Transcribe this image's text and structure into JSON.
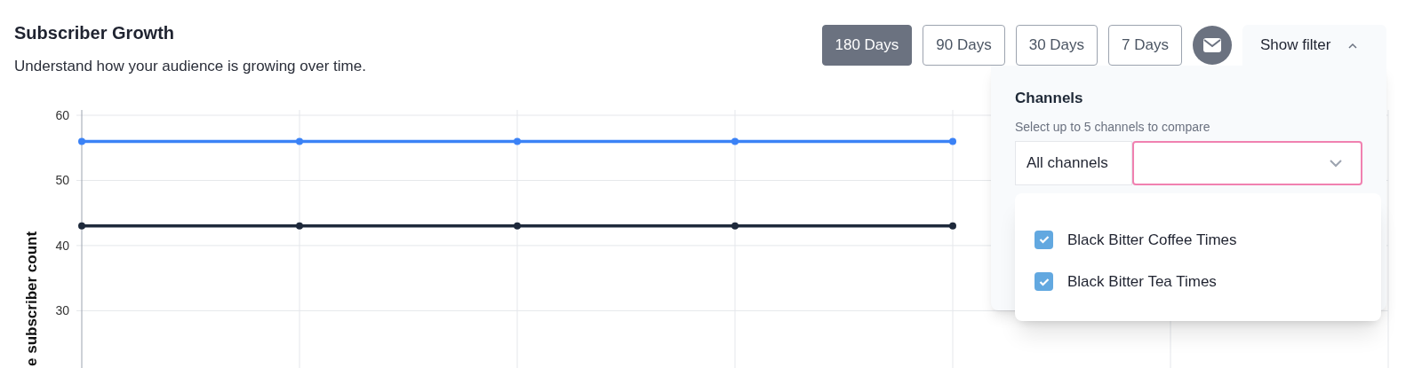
{
  "header": {
    "title": "Subscriber Growth",
    "subtitle": "Understand how your audience is growing over time."
  },
  "range_buttons": [
    {
      "label": "180 Days",
      "selected": true
    },
    {
      "label": "90 Days",
      "selected": false
    },
    {
      "label": "30 Days",
      "selected": false
    },
    {
      "label": "7 Days",
      "selected": false
    }
  ],
  "filter_toggle": {
    "label": "Show filter",
    "expanded": true
  },
  "filter_panel": {
    "title": "Channels",
    "hint": "Select up to 5 channels to compare",
    "scope": "All channels",
    "options": [
      {
        "label": "Black Bitter Coffee Times",
        "checked": true
      },
      {
        "label": "Black Bitter Tea Times",
        "checked": true
      }
    ]
  },
  "chart": {
    "chart_data": {
      "type": "line",
      "ylabel": "e subscriber count",
      "ylim": [
        21.2,
        60
      ],
      "yticks": [
        30,
        40,
        50,
        60
      ],
      "grid": true,
      "series": [
        {
          "color": "#3b82f6",
          "marker": "circle",
          "values": [
            56,
            56,
            56,
            56,
            56
          ]
        },
        {
          "color": "#1e293b",
          "marker": "circle",
          "values": [
            43,
            43,
            43,
            43,
            43
          ]
        }
      ]
    }
  }
}
